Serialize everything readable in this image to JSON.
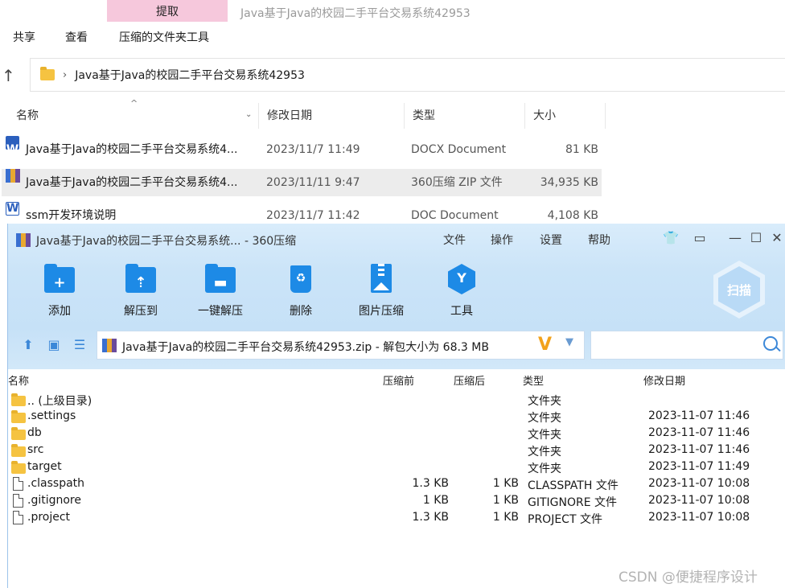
{
  "explorer": {
    "ribbon_tab_active": "提取",
    "window_title": "Java基于Java的校园二手平台交易系统42953",
    "menu": [
      "共享",
      "查看",
      "压缩的文件夹工具"
    ],
    "address_path": "Java基于Java的校园二手平台交易系统42953",
    "columns": {
      "name": "名称",
      "modified": "修改日期",
      "type": "类型",
      "size": "大小"
    },
    "rows": [
      {
        "icon": "word-docx-icon",
        "name": "Java基于Java的校园二手平台交易系统4...",
        "modified": "2023/11/7 11:49",
        "type": "DOCX Document",
        "size": "81 KB",
        "selected": false
      },
      {
        "icon": "zip-archive-icon",
        "name": "Java基于Java的校园二手平台交易系统4...",
        "modified": "2023/11/11 9:47",
        "type": "360压缩 ZIP 文件",
        "size": "34,935 KB",
        "selected": true
      },
      {
        "icon": "word-doc-icon",
        "name": "ssm开发环境说明",
        "modified": "2023/11/7 11:42",
        "type": "DOC Document",
        "size": "4,108 KB",
        "selected": false
      }
    ]
  },
  "zip": {
    "window_title": "Java基于Java的校园二手平台交易系统... - 360压缩",
    "menu": [
      "文件",
      "操作",
      "设置",
      "帮助"
    ],
    "toolbar": [
      {
        "icon": "add-icon",
        "label": "添加"
      },
      {
        "icon": "extract-to-icon",
        "label": "解压到"
      },
      {
        "icon": "one-click-extract-icon",
        "label": "一键解压"
      },
      {
        "icon": "delete-icon",
        "label": "删除"
      },
      {
        "icon": "image-compress-icon",
        "label": "图片压缩"
      },
      {
        "icon": "tools-icon",
        "label": "工具"
      }
    ],
    "scan_label": "扫描",
    "address": "Java基于Java的校园二手平台交易系统42953.zip - 解包大小为 68.3 MB",
    "search_placeholder": "",
    "columns": {
      "name": "名称",
      "before": "压缩前",
      "after": "压缩后",
      "type": "类型",
      "modified": "修改日期"
    },
    "rows": [
      {
        "kind": "folder",
        "name": ".. (上级目录)",
        "before": "",
        "after": "",
        "type": "文件夹",
        "modified": ""
      },
      {
        "kind": "folder",
        "name": ".settings",
        "before": "",
        "after": "",
        "type": "文件夹",
        "modified": "2023-11-07 11:46"
      },
      {
        "kind": "folder",
        "name": "db",
        "before": "",
        "after": "",
        "type": "文件夹",
        "modified": "2023-11-07 11:46"
      },
      {
        "kind": "folder",
        "name": "src",
        "before": "",
        "after": "",
        "type": "文件夹",
        "modified": "2023-11-07 11:46"
      },
      {
        "kind": "folder",
        "name": "target",
        "before": "",
        "after": "",
        "type": "文件夹",
        "modified": "2023-11-07 11:49"
      },
      {
        "kind": "file",
        "name": ".classpath",
        "before": "1.3 KB",
        "after": "1 KB",
        "type": "CLASSPATH 文件",
        "modified": "2023-11-07 10:08"
      },
      {
        "kind": "file",
        "name": ".gitignore",
        "before": "1 KB",
        "after": "1 KB",
        "type": "GITIGNORE 文件",
        "modified": "2023-11-07 10:08"
      },
      {
        "kind": "file",
        "name": ".project",
        "before": "1.3 KB",
        "after": "1 KB",
        "type": "PROJECT 文件",
        "modified": "2023-11-07 10:08"
      }
    ]
  },
  "watermark": "CSDN @便捷程序设计"
}
